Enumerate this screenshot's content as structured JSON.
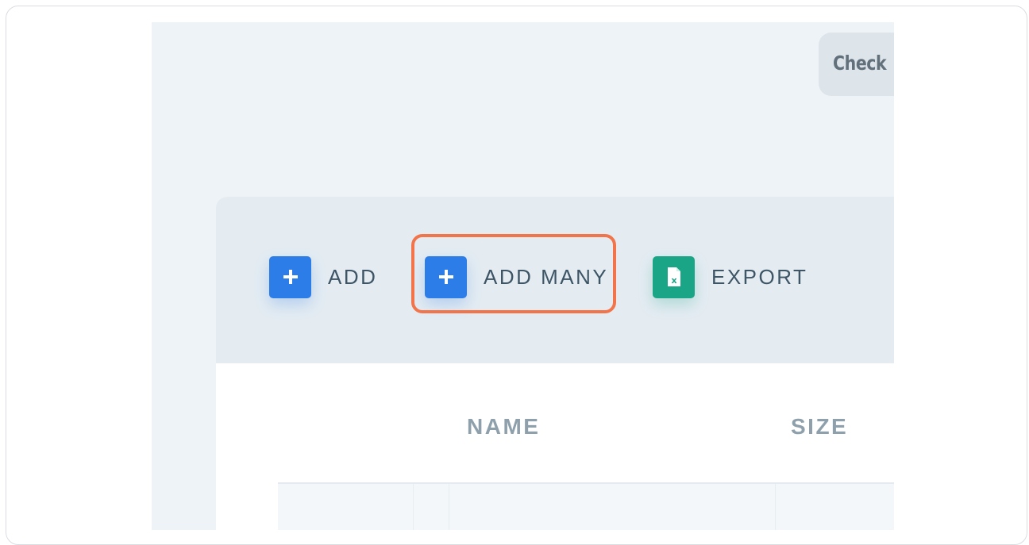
{
  "header": {
    "chip_label": "Check"
  },
  "toolbar": {
    "add_label": "ADD",
    "add_many_label": "ADD MANY",
    "export_label": "EXPORT"
  },
  "table": {
    "columns": [
      "NAME",
      "SIZE"
    ]
  },
  "colors": {
    "accent_blue": "#2d7de8",
    "accent_green": "#1aa587",
    "highlight": "#f2744a"
  },
  "icons": [
    "plus-icon",
    "plus-icon",
    "excel-file-icon"
  ]
}
